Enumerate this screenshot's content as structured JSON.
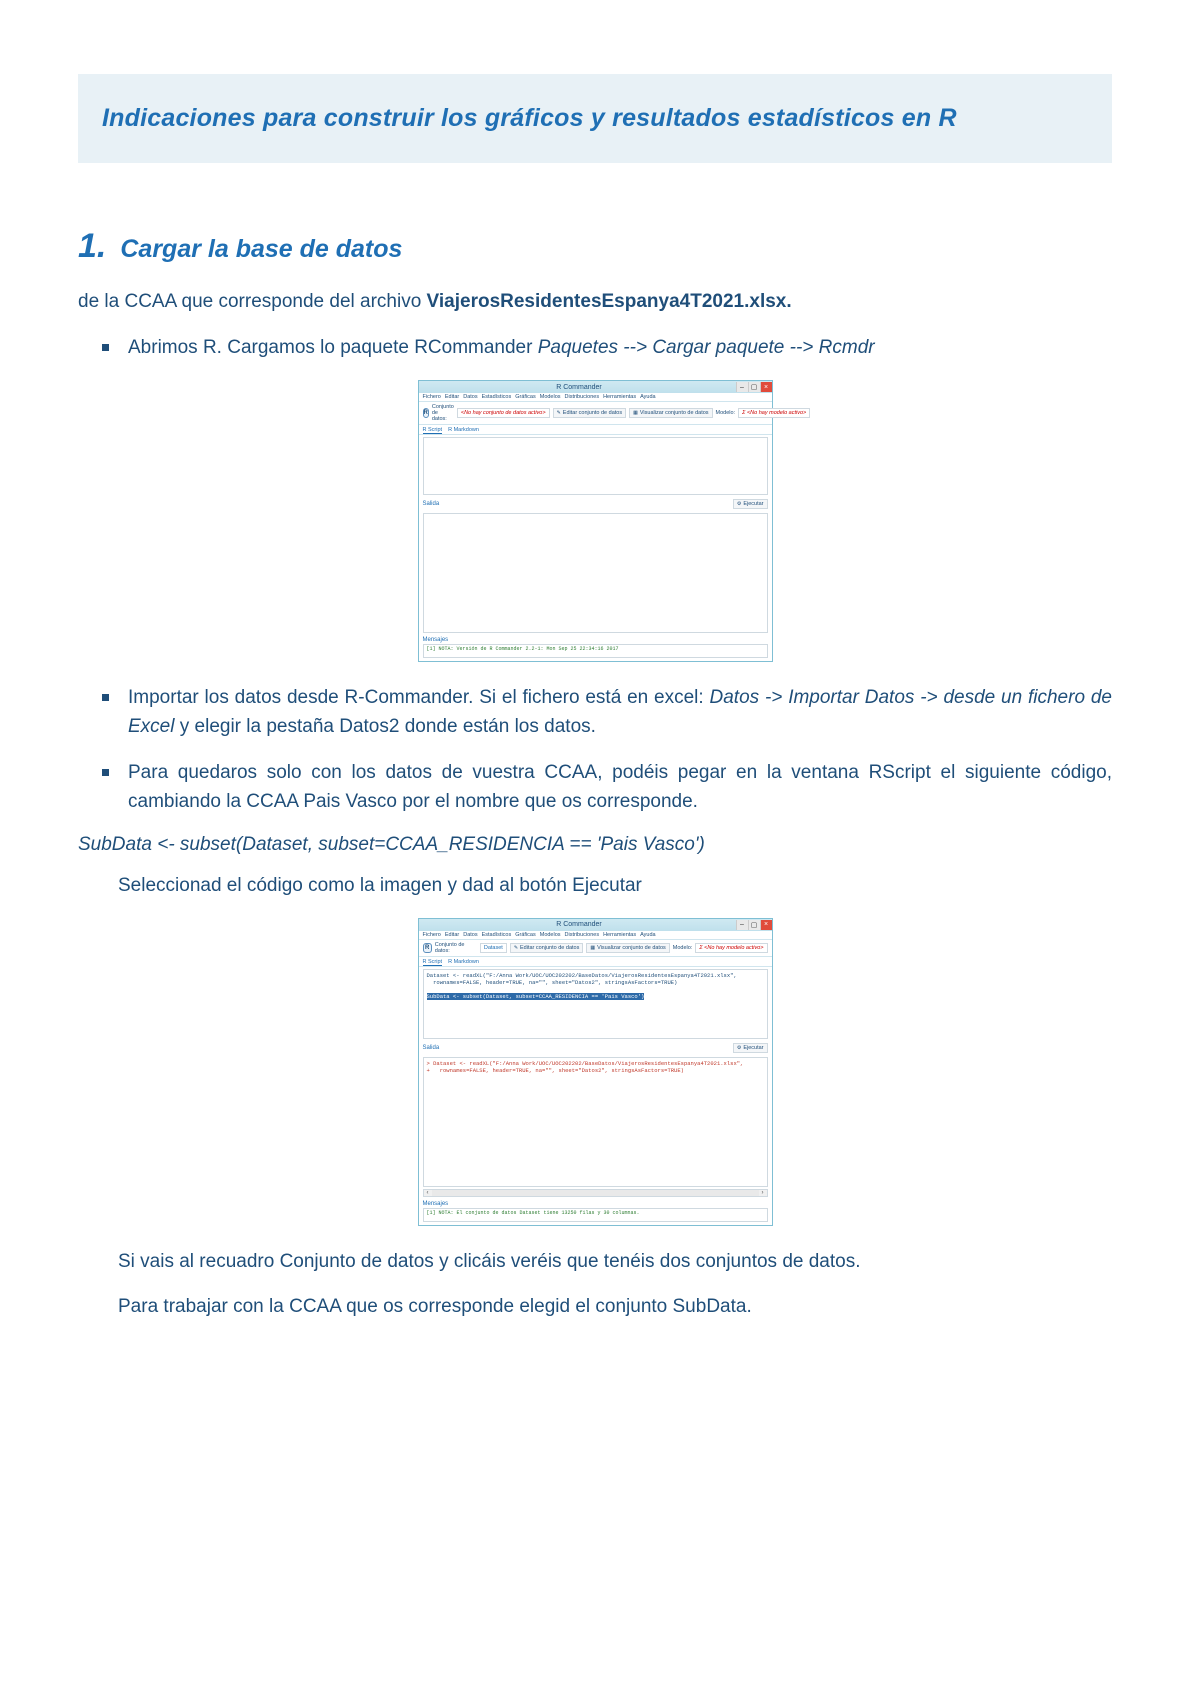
{
  "banner": {
    "heading": "Indicaciones para construir los gráficos y resultados estadísticos en R"
  },
  "section1": {
    "number": "1.",
    "title": "Cargar la base de datos",
    "intro_pre": "de la CCAA que corresponde del archivo ",
    "intro_bold": "ViajerosResidentesEspanya4T2021.xlsx.",
    "bullet1_pre": "Abrimos R. Cargamos lo paquete RCommander ",
    "bullet1_em": "Paquetes --> Cargar paquete --> Rcmdr",
    "bullet2_pre": "Importar los datos desde R-Commander. Si el fichero está en excel: ",
    "bullet2_em": "Datos -> Importar Datos -> desde un fichero de Excel",
    "bullet2_post": " y elegir la pestaña Datos2 donde están los datos.",
    "bullet3": "Para quedaros solo con los datos de vuestra CCAA, podéis pegar en la ventana RScript el siguiente código, cambiando la CCAA Pais Vasco por el nombre que os corresponde.",
    "code": "SubData <- subset(Dataset, subset=CCAA_RESIDENCIA == 'Pais Vasco')",
    "select_instr": "Seleccionad el código como la imagen y dad al botón Ejecutar",
    "outro1": "Si vais al recuadro Conjunto de datos y clicáis veréis que tenéis dos conjuntos de datos.",
    "outro2": "Para trabajar con la CCAA que os corresponde elegid el conjunto SubData."
  },
  "rc": {
    "title": "R Commander",
    "menus": [
      "Fichero",
      "Editar",
      "Datos",
      "Estadísticos",
      "Gráficas",
      "Modelos",
      "Distribuciones",
      "Herramientas",
      "Ayuda"
    ],
    "toolbar": {
      "conjunto_label": "Conjunto de datos:",
      "conjunto_none": "<No hay conjunto de datos activo>",
      "conjunto_dataset": "Dataset",
      "editar": "Editar conjunto de datos",
      "visualizar": "Visualizar conjunto de datos",
      "modelo_label": "Modelo:",
      "modelo_none": "Σ <No hay modelo activo>"
    },
    "tabs": {
      "script": "R Script",
      "markdown": "R Markdown"
    },
    "salida": "Salida",
    "ejecutar": "Ejecutar",
    "mensajes": "Mensajes",
    "msg1": "[1] NOTA: Versión de R Commander 2.2-1: Mon Sep 25 22:34:16 2017",
    "script2_line1": "Dataset <- readXL(\"F:/Anna Work/UOC/UOC202202/BaseDatos/ViajerosResidentesEspanya4T2021.xlsx\",",
    "script2_line2": "  rownames=FALSE, header=TRUE, na=\"\", sheet=\"Datos2\", stringsAsFactors=TRUE)",
    "script2_highlight": "SubData <- subset(Dataset, subset=CCAA_RESIDENCIA == 'Pais Vasco')",
    "output2_line1": "> Dataset <- readXL(\"F:/Anna Work/UOC/UOC202202/BaseDatos/ViajerosResidentesEspanya4T2021.xlsx\",",
    "output2_line2": "+   rownames=FALSE, header=TRUE, na=\"\", sheet=\"Datos2\", stringsAsFactors=TRUE)",
    "msg2": "[1] NOTA: El conjunto de datos Dataset tiene 13250 filas y 30 columnas."
  }
}
